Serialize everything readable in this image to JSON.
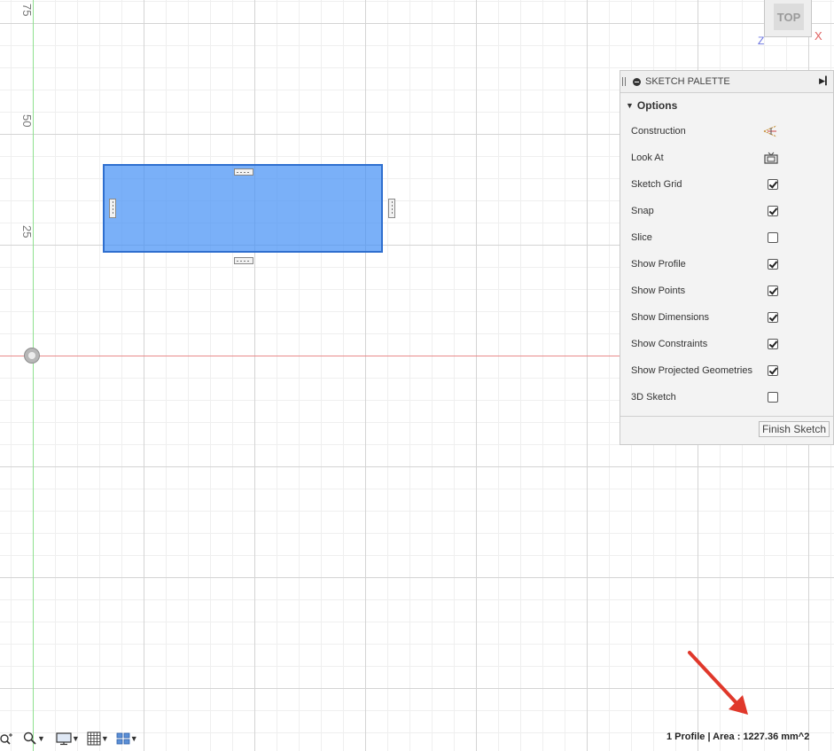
{
  "canvas": {
    "y_axis_ticks": [
      "75",
      "50",
      "25"
    ],
    "colors": {
      "profile_fill": "#6aa6f5",
      "profile_border": "#2f6fcf",
      "x_axis": "#e88a8a",
      "y_axis": "#8fe08f"
    }
  },
  "viewcube": {
    "face_label": "TOP",
    "x_axis_label": "X",
    "z_axis_label": "Z"
  },
  "palette": {
    "title": "SKETCH PALETTE",
    "section_title": "Options",
    "rows": [
      {
        "label": "Construction",
        "control": "construction-icon"
      },
      {
        "label": "Look At",
        "control": "look-at-icon"
      },
      {
        "label": "Sketch Grid",
        "control": "checkbox",
        "checked": true
      },
      {
        "label": "Snap",
        "control": "checkbox",
        "checked": true
      },
      {
        "label": "Slice",
        "control": "checkbox",
        "checked": false
      },
      {
        "label": "Show Profile",
        "control": "checkbox",
        "checked": true
      },
      {
        "label": "Show Points",
        "control": "checkbox",
        "checked": true
      },
      {
        "label": "Show Dimensions",
        "control": "checkbox",
        "checked": true
      },
      {
        "label": "Show Constraints",
        "control": "checkbox",
        "checked": true
      },
      {
        "label": "Show Projected Geometries",
        "control": "checkbox",
        "checked": true
      },
      {
        "label": "3D Sketch",
        "control": "checkbox",
        "checked": false
      }
    ],
    "finish_label": "Finish Sketch"
  },
  "toolbar": {
    "buttons": [
      "zoom-window-icon",
      "zoom-icon",
      "display-settings-icon",
      "grid-settings-icon",
      "viewports-icon"
    ]
  },
  "status": {
    "text": "1 Profile | Area : 1227.36 mm^2"
  },
  "annotation": {
    "arrow_color": "#e0382b"
  }
}
